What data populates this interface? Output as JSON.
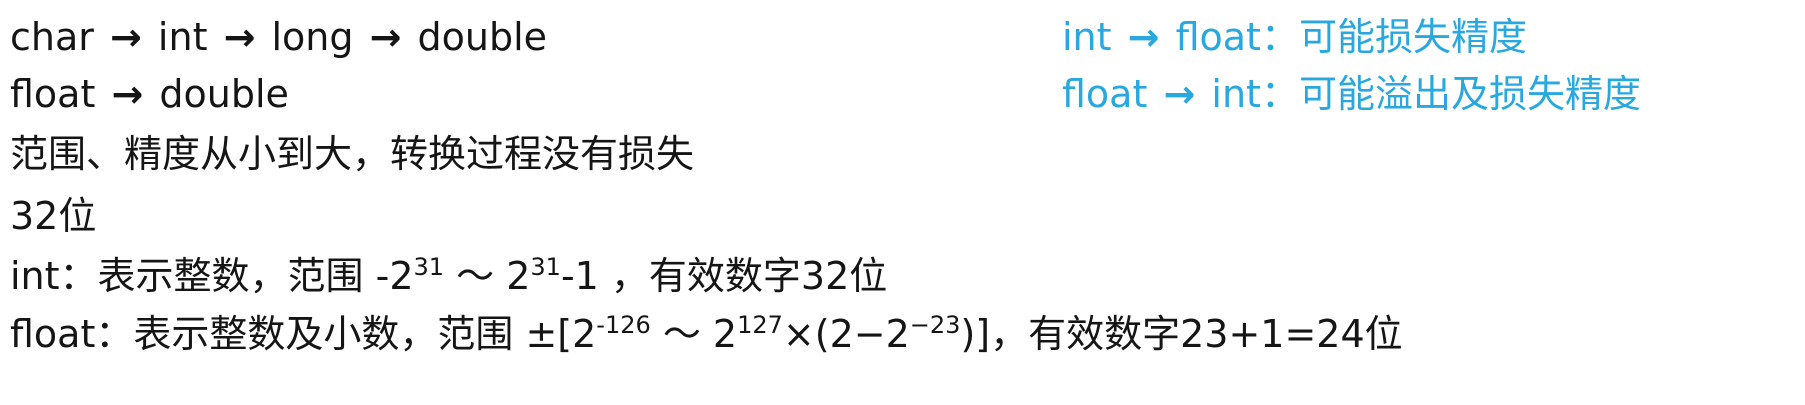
{
  "left_lines": {
    "line1": {
      "t1": "char",
      "t2": "int",
      "t3": "long",
      "t4": "double"
    },
    "line2": {
      "t1": "float",
      "t2": "double"
    },
    "line3": "范围、精度从小到大，转换过程没有损失",
    "line4": "32位",
    "line5": {
      "prefix": "int：表示整数，范围 -2",
      "sup1": "31",
      "mid": " ～ 2",
      "sup2": "31",
      "suffix": "-1 ，有效数字32位"
    },
    "line6": {
      "prefix": "float：表示整数及小数，范围 ±[2",
      "sup1": "-126",
      "mid": " ～ 2",
      "sup2": "127",
      "mid2": "×(2−2",
      "sup3": "−23",
      "suffix": ")]，有效数字23+1=24位"
    }
  },
  "right_notes": {
    "note1": {
      "a": "int",
      "b": "float：可能损失精度"
    },
    "note2": {
      "a": "float",
      "b": "int：可能溢出及损失精度"
    }
  },
  "arrow_symbol": "→",
  "colors": {
    "accent": "#29a8e0",
    "text": "#151515"
  }
}
